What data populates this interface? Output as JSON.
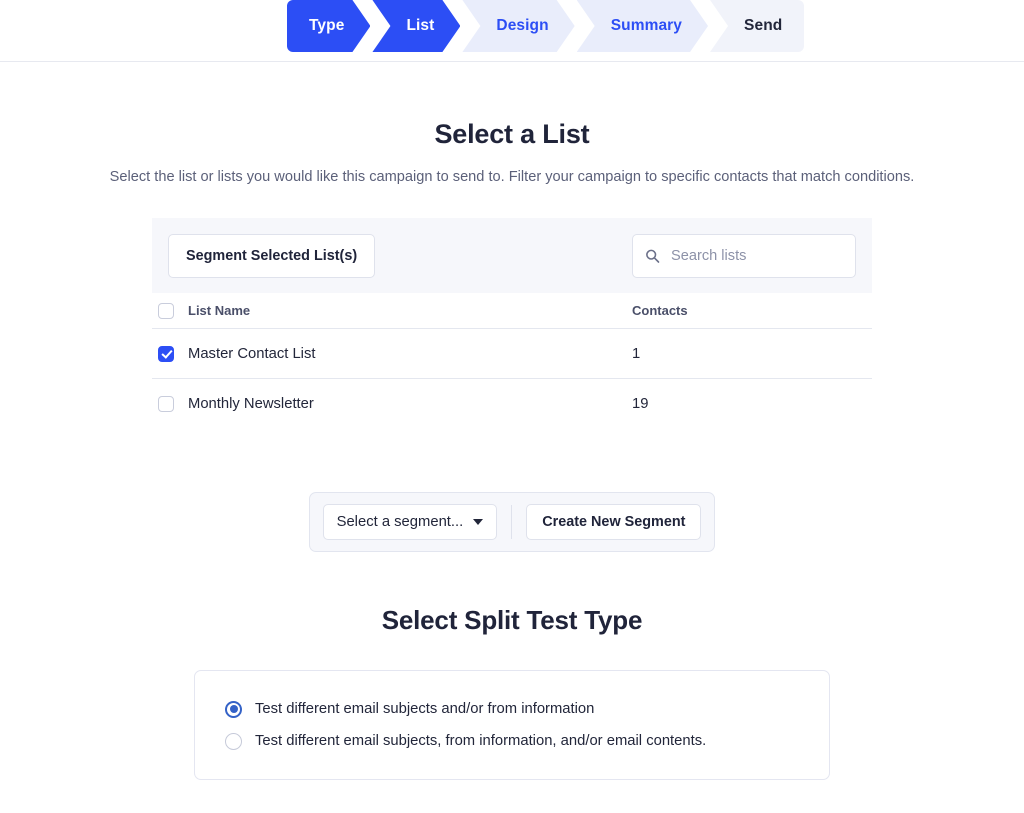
{
  "wizard": {
    "steps": [
      {
        "label": "Type",
        "state": "active"
      },
      {
        "label": "List",
        "state": "active"
      },
      {
        "label": "Design",
        "state": "upcoming"
      },
      {
        "label": "Summary",
        "state": "upcoming"
      },
      {
        "label": "Send",
        "state": "plain"
      }
    ]
  },
  "page": {
    "title": "Select a List",
    "subtitle": "Select the list or lists you would like this campaign to send to. Filter your campaign to specific contacts that match conditions."
  },
  "toolbar": {
    "segment_button_label": "Segment Selected List(s)",
    "search_placeholder": "Search lists",
    "search_value": "",
    "search_icon": "search-icon"
  },
  "table": {
    "columns": [
      "List Name",
      "Contacts"
    ],
    "header_checkbox_checked": false,
    "rows": [
      {
        "checked": true,
        "name": "Master Contact List",
        "contacts": "1"
      },
      {
        "checked": false,
        "name": "Monthly Newsletter",
        "contacts": "19"
      }
    ]
  },
  "segment_bar": {
    "select_label": "Select a segment...",
    "caret_icon": "chevron-down-icon",
    "create_label": "Create New Segment"
  },
  "split_test": {
    "title": "Select Split Test Type",
    "options": [
      {
        "label": "Test different email subjects and/or from information",
        "selected": true
      },
      {
        "label": "Test different email subjects, from information, and/or email contents.",
        "selected": false
      }
    ]
  },
  "colors": {
    "accent": "#2c4ef5",
    "step_upcoming_bg": "#e9edfb",
    "step_plain_bg": "#f1f3fa",
    "panel_bg": "#f6f7fb",
    "border": "#e4e7ef",
    "text": "#22263a",
    "muted": "#5b6079",
    "radio_accent": "#3462c7"
  }
}
